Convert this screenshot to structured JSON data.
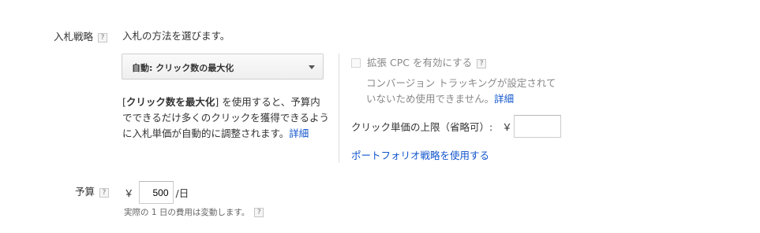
{
  "bid_strategy": {
    "label": "入札戦略",
    "help": "?",
    "description": "入札の方法を選びます。",
    "select_value": "自動: クリック数の最大化",
    "explain_prefix": "[",
    "explain_bold": "クリック数を最大化",
    "explain_rest": "] を使用すると、予算内でできるだけ多くのクリックを獲得できるように入札単価が自動的に調整されます。",
    "explain_link": "詳細"
  },
  "enhanced_cpc": {
    "label": "拡張 CPC を有効にする",
    "help": "?",
    "note": "コンバージョン トラッキングが設定されていないため使用できません。",
    "note_link": "詳細"
  },
  "max_cpc": {
    "label": "クリック単価の上限（省略可）:",
    "currency": "￥",
    "value": ""
  },
  "portfolio_link": "ポートフォリオ戦略を使用する",
  "budget": {
    "label": "予算",
    "help": "?",
    "currency": "￥",
    "value": "500",
    "unit": "/日",
    "note": "実際の 1 日の費用は変動します。",
    "note_help": "?"
  },
  "colors": {
    "link": "#1155cc",
    "disabled_text": "#888888"
  }
}
